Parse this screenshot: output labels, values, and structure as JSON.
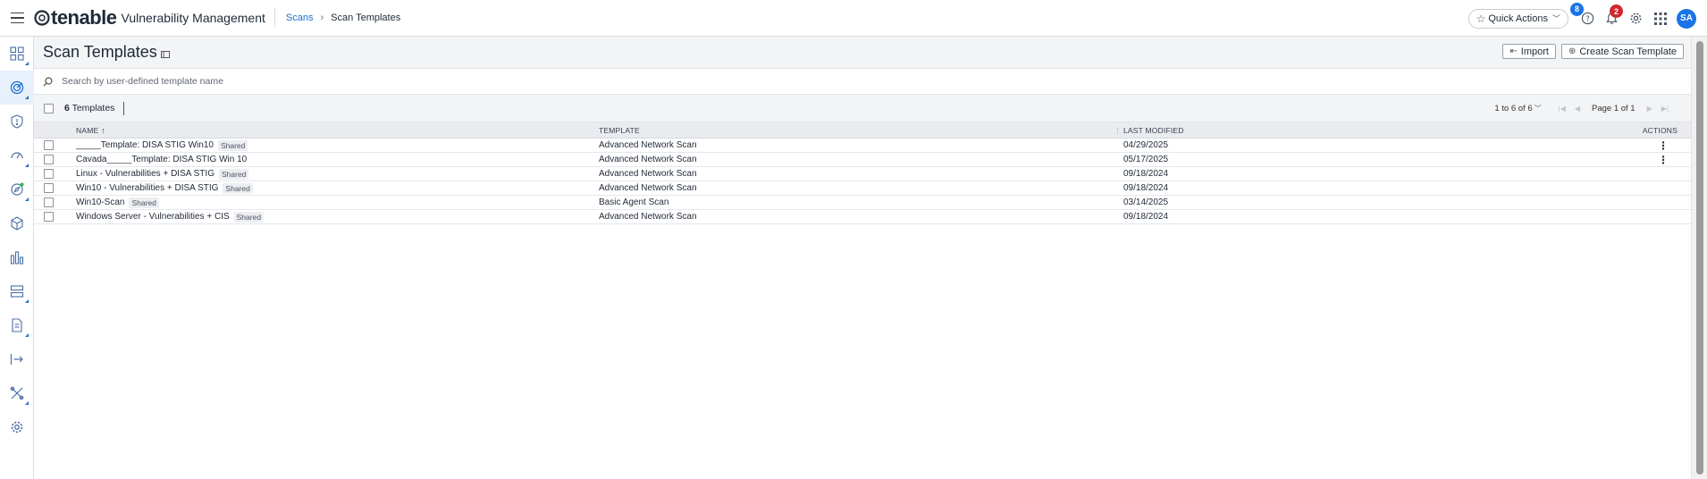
{
  "topbar": {
    "brand_name": "tenable",
    "product_name": "Vulnerability Management",
    "breadcrumb_root": "Scans",
    "breadcrumb_current": "Scan Templates",
    "quick_actions_label": "Quick Actions",
    "help_badge": "8",
    "notification_badge": "2",
    "avatar_initials": "SA"
  },
  "page": {
    "title": "Scan Templates",
    "import_label": "Import",
    "create_label": "Create Scan Template",
    "search_placeholder": "Search by user-defined template name"
  },
  "list": {
    "count_number": "6",
    "count_label": "Templates",
    "range": "1 to 6 of 6",
    "page_label": "Page 1 of 1",
    "columns": {
      "name": "NAME",
      "template": "TEMPLATE",
      "last_modified": "LAST MODIFIED",
      "actions": "ACTIONS"
    },
    "rows": [
      {
        "name": "_____Template: DISA STIG Win10",
        "shared": "Shared",
        "template": "Advanced Network Scan",
        "modified": "04/29/2025",
        "has_actions": true
      },
      {
        "name": "Cavada_____Template: DISA STIG Win 10",
        "shared": "",
        "template": "Advanced Network Scan",
        "modified": "05/17/2025",
        "has_actions": true
      },
      {
        "name": "Linux - Vulnerabilities + DISA STIG",
        "shared": "Shared",
        "template": "Advanced Network Scan",
        "modified": "09/18/2024",
        "has_actions": false
      },
      {
        "name": "Win10 - Vulnerabilities + DISA STIG",
        "shared": "Shared",
        "template": "Advanced Network Scan",
        "modified": "09/18/2024",
        "has_actions": false
      },
      {
        "name": "Win10-Scan",
        "shared": "Shared",
        "template": "Basic Agent Scan",
        "modified": "03/14/2025",
        "has_actions": false
      },
      {
        "name": "Windows Server - Vulnerabilities + CIS",
        "shared": "Shared",
        "template": "Advanced Network Scan",
        "modified": "09/18/2024",
        "has_actions": false
      }
    ]
  },
  "sidebar": {
    "items": [
      {
        "icon": "dashboard-grid-icon",
        "active": false
      },
      {
        "icon": "scans-radar-icon",
        "active": true
      },
      {
        "icon": "shield-icon",
        "active": false
      },
      {
        "icon": "gauge-icon",
        "active": false
      },
      {
        "icon": "compass-icon",
        "active": false
      },
      {
        "icon": "cube-icon",
        "active": false
      },
      {
        "icon": "analytics-chart-icon",
        "active": false
      },
      {
        "icon": "stack-layers-icon",
        "active": false
      },
      {
        "icon": "report-document-icon",
        "active": false
      },
      {
        "icon": "export-arrow-icon",
        "active": false
      },
      {
        "icon": "tools-icon",
        "active": false
      },
      {
        "icon": "settings-gear-icon",
        "active": false
      }
    ]
  },
  "colors": {
    "accent": "#1a73e8",
    "link": "#1a6fcf",
    "alert": "#d0282e"
  }
}
